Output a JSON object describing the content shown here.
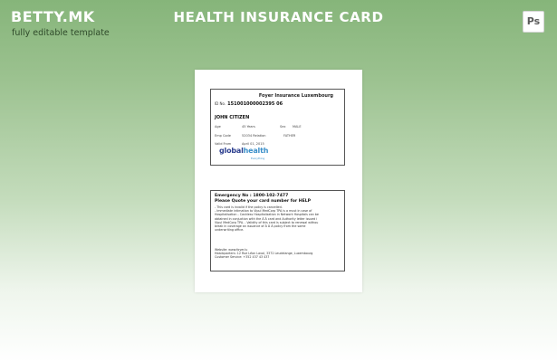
{
  "branding": {
    "name": "BETTY.MK",
    "tagline": "fully editable template"
  },
  "header": {
    "title": "HEALTH INSURANCE CARD",
    "app_badge": "Ps"
  },
  "card_front": {
    "company": "Foyer Insurance Luxembourg",
    "id_label": "ID No.",
    "id_number": "151001000002395 06",
    "holder_name": "JOHN CITIZEN",
    "age_label": "Age",
    "age_value": "45 Years",
    "sex_label": "Sex",
    "sex_value": "MALE",
    "emp_label": "Emp Code",
    "emp_value": "52034 Relation",
    "relation_value": "FATHER",
    "valid_label": "Valid From",
    "valid_value": "April 01, 2015",
    "logo_part1": "global",
    "logo_part2": "health",
    "logo_sub": "Everything"
  },
  "card_back": {
    "emergency": "Emergency No : 1800-102-7477",
    "quote": "Please Quote your card number for HELP",
    "terms": [
      "- This card is invalid if the policy is cancelled.",
      "- Immediate intimation to Vipul MedCorp TPA is a must in case of",
      "Hospitalisation - Cashless Hospitalization in Network Hospitals can be",
      "obtained in conjuction with the Â Â card and Authority letter issued i",
      "Vipul MedCorp TPA. - Validity of this card is subject to renewal withou",
      "break in coverage an issuance of Â Â Â policy from the same",
      "underwriting office."
    ],
    "website": "Website: www.foyer.lu",
    "headquarters": "Headquarters: 12 Rue Léon Laval, 3372 Leudelange, Luxembourg",
    "customer_service": "Customer Service: +352 437 43 437"
  },
  "colors": {
    "background_top": "#86b57a",
    "background_bottom": "#ffffff",
    "logo_dark": "#2d3f8f",
    "logo_light": "#3a8fc9"
  }
}
